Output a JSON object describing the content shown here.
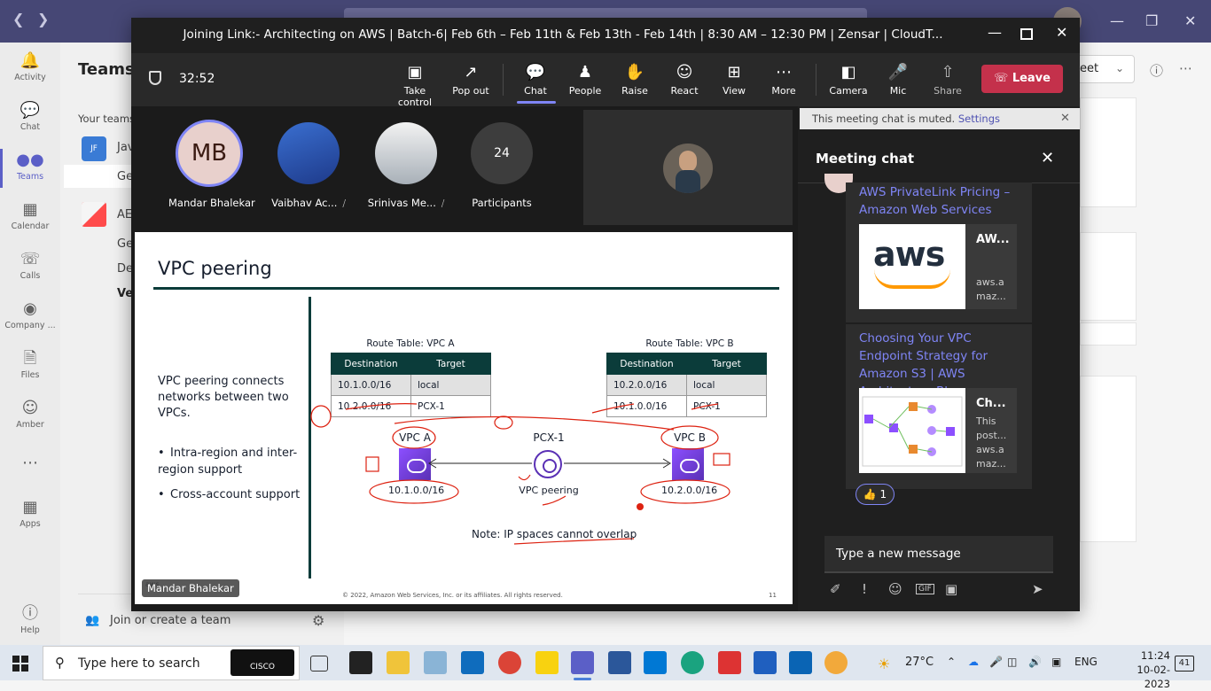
{
  "meeting": {
    "title": "Joining Link:- Architecting on AWS | Batch-6| Feb 6th – Feb 11th & Feb 13th - Feb 14th | 8:30 AM – 12:30 PM | Zensar | CloudT...",
    "timer": "32:52",
    "toolbar": [
      {
        "label": "Take control",
        "icon": "take-control-icon"
      },
      {
        "label": "Pop out",
        "icon": "pop-out-icon"
      },
      {
        "label": "Chat",
        "icon": "chat-icon"
      },
      {
        "label": "People",
        "icon": "people-icon"
      },
      {
        "label": "Raise",
        "icon": "raise-hand-icon"
      },
      {
        "label": "React",
        "icon": "react-icon"
      },
      {
        "label": "View",
        "icon": "view-icon"
      },
      {
        "label": "More",
        "icon": "more-icon"
      },
      {
        "label": "Camera",
        "icon": "camera-off-icon"
      },
      {
        "label": "Mic",
        "icon": "mic-off-icon"
      },
      {
        "label": "Share",
        "icon": "share-icon"
      }
    ],
    "leave_label": "Leave",
    "participants": [
      {
        "name": "Mandar Bhalekar",
        "initials": "MB"
      },
      {
        "name": "Vaibhav Ac..."
      },
      {
        "name": "Srinivas Me..."
      },
      {
        "name": "Participants",
        "count": "24"
      }
    ],
    "presenter_tag": "Mandar Bhalekar"
  },
  "slide": {
    "title": "VPC peering",
    "description": "VPC peering connects networks between two VPCs.",
    "bullets": [
      "Intra-region and inter-region support",
      "Cross-account support"
    ],
    "route_table_a": {
      "caption": "Route Table: VPC A",
      "headers": [
        "Destination",
        "Target"
      ],
      "rows": [
        [
          "10.1.0.0/16",
          "local"
        ],
        [
          "10.2.0.0/16",
          "PCX-1"
        ]
      ]
    },
    "route_table_b": {
      "caption": "Route Table: VPC B",
      "headers": [
        "Destination",
        "Target"
      ],
      "rows": [
        [
          "10.2.0.0/16",
          "local"
        ],
        [
          "10.1.0.0/16",
          "PCX-1"
        ]
      ]
    },
    "vpc_a": {
      "label": "VPC A",
      "cidr": "10.1.0.0/16"
    },
    "vpc_b": {
      "label": "VPC B",
      "cidr": "10.2.0.0/16"
    },
    "pcx_label": "PCX-1",
    "peering_label": "VPC peering",
    "note": "Note: IP spaces cannot overlap",
    "footer": "© 2022, Amazon Web Services, Inc. or its affiliates. All rights reserved.",
    "page_number": "11",
    "logo_text": "aws"
  },
  "chat": {
    "mute_banner": "This meeting chat is muted.",
    "settings_link": "Settings",
    "header": "Meeting chat",
    "messages": [
      {
        "link_title": "AWS PrivateLink Pricing – Amazon Web Services",
        "preview_title": "AW...",
        "preview_sub": "aws.a maz..."
      },
      {
        "link_title": "Choosing Your VPC Endpoint Strategy for Amazon S3 | AWS Architecture Blog",
        "preview_title": "Ch...",
        "preview_sub": "This post... aws.a maz..."
      }
    ],
    "reaction": "👍 1",
    "compose_placeholder": "Type a new message"
  },
  "teams": {
    "left_rail": [
      {
        "label": "Activity",
        "icon": "bell-icon"
      },
      {
        "label": "Chat",
        "icon": "chat-icon"
      },
      {
        "label": "Teams",
        "icon": "teams-icon"
      },
      {
        "label": "Calendar",
        "icon": "calendar-icon"
      },
      {
        "label": "Calls",
        "icon": "phone-icon"
      },
      {
        "label": "Company ...",
        "icon": "company-icon"
      },
      {
        "label": "Files",
        "icon": "file-icon"
      },
      {
        "label": "Amber",
        "icon": "amber-icon"
      },
      {
        "label": "Apps",
        "icon": "apps-icon"
      },
      {
        "label": "Help",
        "icon": "help-icon"
      }
    ],
    "panel_title": "Teams",
    "your_teams": "Your teams",
    "team1_avatar": "JF",
    "team1_name": "Jav",
    "team1_channel": "Ge",
    "team2_name": "AE",
    "team2_channels": [
      "Ge",
      "De",
      "Ve"
    ],
    "join_create": "Join or create a team",
    "meet_btn": "eet"
  },
  "taskbar": {
    "search_placeholder": "Type here to search",
    "cisco_label": "CISCO",
    "weather": "27°C",
    "language": "ENG",
    "time": "11:24",
    "date": "10-02-2023",
    "notifications": "41"
  }
}
